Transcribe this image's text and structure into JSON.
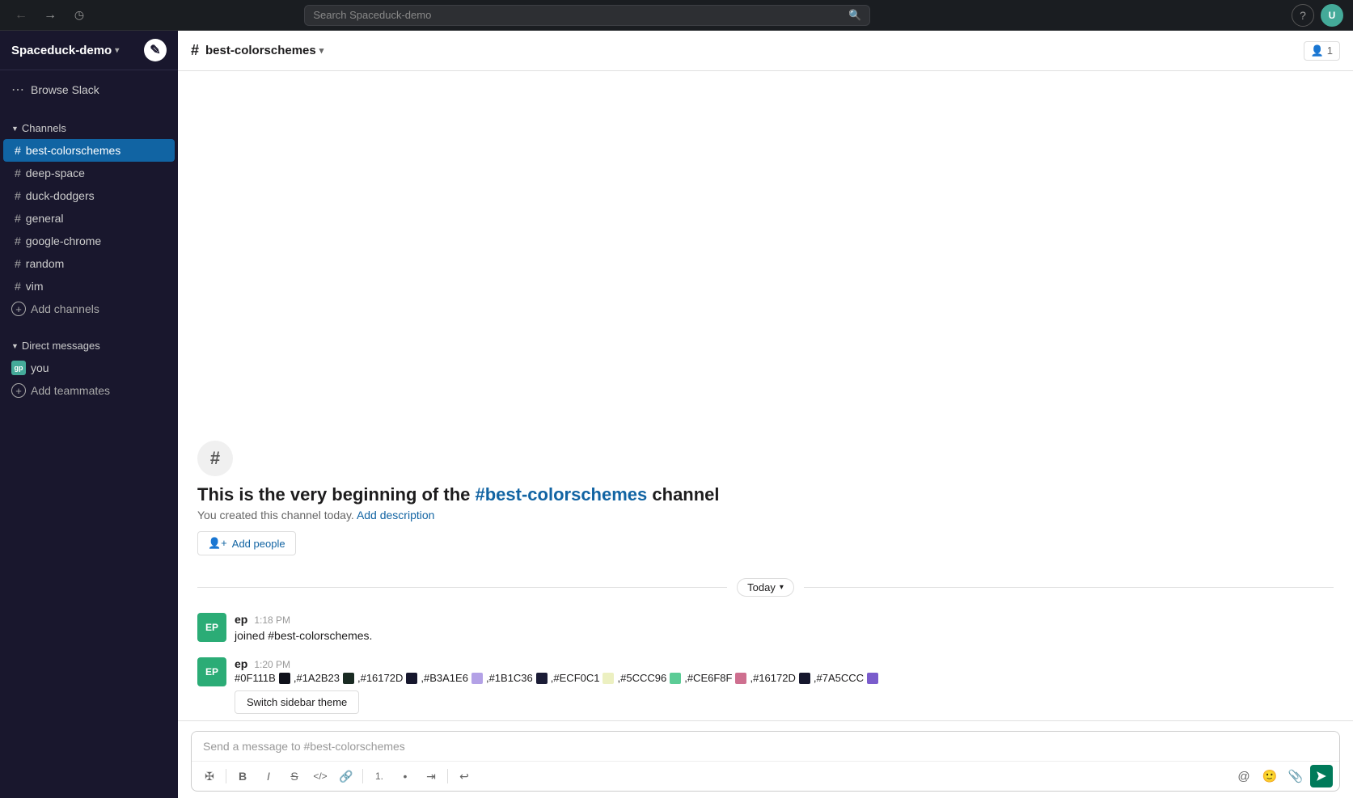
{
  "app": {
    "title": "Spaceduck-demo"
  },
  "topbar": {
    "search_placeholder": "Search Spaceduck-demo",
    "back_disabled": false,
    "forward_disabled": true
  },
  "sidebar": {
    "workspace_name": "Spaceduck-demo",
    "browse_label": "Browse Slack",
    "channels_label": "Channels",
    "channels": [
      {
        "name": "best-colorschemes",
        "active": true
      },
      {
        "name": "deep-space",
        "active": false
      },
      {
        "name": "duck-dodgers",
        "active": false
      },
      {
        "name": "general",
        "active": false
      },
      {
        "name": "google-chrome",
        "active": false
      },
      {
        "name": "random",
        "active": false
      },
      {
        "name": "vim",
        "active": false
      }
    ],
    "add_channels_label": "Add channels",
    "direct_messages_label": "Direct messages",
    "dm_items": [
      {
        "initials": "gp",
        "name": "you",
        "status": "you"
      }
    ],
    "add_teammates_label": "Add teammates"
  },
  "channel": {
    "name": "best-colorschemes",
    "members_count": "1",
    "beginning_text": "This is the very beginning of the",
    "channel_link": "#best-colorschemes",
    "channel_suffix": "channel",
    "created_text": "You created this channel today.",
    "add_description_label": "Add description",
    "add_people_label": "Add people"
  },
  "date_separator": {
    "label": "Today",
    "chevron": "▾"
  },
  "messages": [
    {
      "avatar_initials": "EP",
      "username": "ep",
      "time": "1:18 PM",
      "text": "joined #best-colorschemes."
    },
    {
      "avatar_initials": "EP",
      "username": "ep",
      "time": "1:20 PM",
      "has_colors": true,
      "theme_btn_label": "Switch sidebar theme"
    }
  ],
  "color_theme": {
    "colors": [
      {
        "hex": "#0F111B",
        "label": "#0F111B"
      },
      {
        "hex": "#1A2B23",
        "label": "#1A2B23"
      },
      {
        "hex": "#16172D",
        "label": "#16172D"
      },
      {
        "hex": "#B3A1E6",
        "label": "#B3A1E6"
      },
      {
        "hex": "#1B1C36",
        "label": "#1B1C36"
      },
      {
        "hex": "#ECF0C1",
        "label": "#ECF0C1"
      },
      {
        "hex": "#5CCC96",
        "label": "#5CCC96"
      },
      {
        "hex": "#CE6F8F",
        "label": "#CE6F8F"
      },
      {
        "hex": "#16172D",
        "label": "#16172D"
      },
      {
        "hex": "#7A5CCC",
        "label": "#7A5CCC"
      }
    ]
  },
  "input": {
    "placeholder": "Send a message to #best-colorschemes"
  },
  "toolbar": {
    "bold": "B",
    "italic": "I",
    "strike": "S",
    "code": "<>",
    "link": "🔗",
    "ordered_list": "ol",
    "unordered_list": "ul",
    "indent": "»",
    "undo": "↩"
  }
}
